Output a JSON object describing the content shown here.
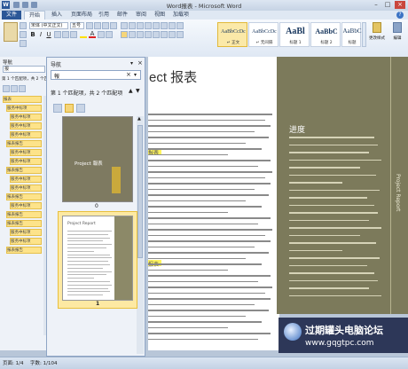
{
  "window": {
    "title": "Word报表 - Microsoft Word"
  },
  "tabs": {
    "file": "文件",
    "home": "开始",
    "items": [
      {
        "label": "插入",
        "id": "tab-insert"
      },
      {
        "label": "页面布局",
        "id": "tab-page-layout"
      },
      {
        "label": "引用",
        "id": "tab-references"
      },
      {
        "label": "邮件",
        "id": "tab-mailings"
      },
      {
        "label": "审阅",
        "id": "tab-review"
      },
      {
        "label": "视图",
        "id": "tab-view"
      },
      {
        "label": "加载项",
        "id": "tab-addins"
      }
    ]
  },
  "ribbon": {
    "font_name": "宋体 (中文正文)",
    "font_size": "五号",
    "styles": [
      {
        "sample": "AaBbCcDc",
        "name": "↵ 正文"
      },
      {
        "sample": "AaBbCcDc",
        "name": "↵ 无间隔"
      },
      {
        "sample": "AaBl",
        "name": "标题 1"
      },
      {
        "sample": "AaBbC",
        "name": "标题 2"
      },
      {
        "sample": "AaBbC",
        "name": "标题"
      }
    ],
    "change_styles": "更改样式",
    "editing": "编辑"
  },
  "nav_back": {
    "title": "导航",
    "search_value": "报",
    "result": "第 1 个匹配项，共 2 个匹配项",
    "items": [
      "报表",
      "服务中标项",
      "服务中标项",
      "服务中标项",
      "服务中标项",
      "报表报告",
      "服务中标项",
      "服务中标项",
      "报表报告",
      "服务中标项",
      "服务中标项",
      "报表报告",
      "服务中标项",
      "报表报告",
      "报表报告",
      "服务中标项",
      "服务中标项",
      "报表报告"
    ]
  },
  "nav_front": {
    "title": "导航",
    "search_value": "報",
    "result": "第 1 个匹配项，共 2 个匹配项",
    "thumbs": [
      {
        "cover_text": "Project 報表",
        "page_num": "0"
      },
      {
        "cover_text": "Project Report",
        "page_num": "1"
      }
    ]
  },
  "document": {
    "heading": "ect 报表",
    "highlight1": "报表",
    "highlight2": "报表",
    "side_title": "进度",
    "side_vertical": "Project Report"
  },
  "status": {
    "page": "页面: 1/4",
    "words": "字数: 1/104"
  },
  "watermark": {
    "text": "过期罐头电脑论坛",
    "url": "www.gqgtpc.com"
  }
}
